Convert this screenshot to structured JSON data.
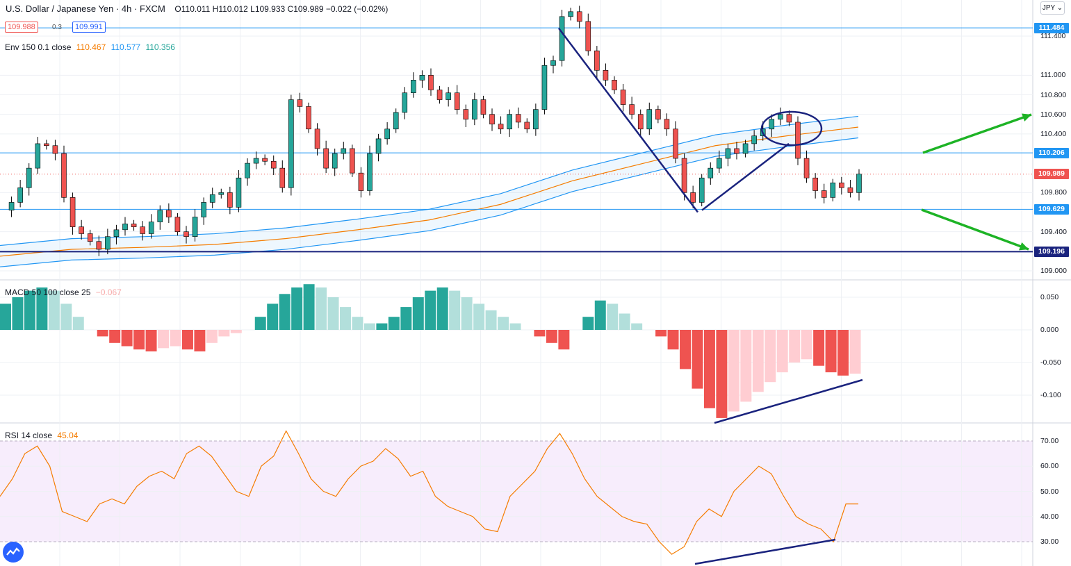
{
  "header": {
    "symbol": "U.S. Dollar / Japanese Yen · 4h · FXCM",
    "ohlc": "O110.011 H110.012 L109.933 C109.989 −0.022 (−0.02%)",
    "bid": "109.988",
    "spread": "0.3",
    "ask": "109.991",
    "currency_button": "JPY ⌄"
  },
  "indicators": {
    "env": {
      "label": "Env 150 0.1 close",
      "v1": "110.467",
      "v2": "110.577",
      "v3": "110.356",
      "c1": "#f57c00",
      "c2": "#2196f3",
      "c3": "#26a69a"
    },
    "macd": {
      "label": "MACD 50 100 close 25",
      "value": "−0.067"
    },
    "rsi": {
      "label": "RSI 14 close",
      "value": "45.04"
    }
  },
  "price_axis": [
    "111.400",
    "111.000",
    "110.800",
    "110.600",
    "110.400",
    "109.800",
    "109.400",
    "109.000"
  ],
  "price_tags": [
    {
      "label": "111.484",
      "color": "#2196f3"
    },
    {
      "label": "110.206",
      "color": "#2196f3"
    },
    {
      "label": "109.989",
      "color": "#ef5350"
    },
    {
      "label": "109.629",
      "color": "#2196f3"
    },
    {
      "label": "109.196",
      "color": "#1a237e"
    }
  ],
  "macd_axis": [
    "0.050",
    "0.000",
    "-0.050",
    "-0.100"
  ],
  "rsi_axis": [
    "70.00",
    "60.00",
    "50.00",
    "40.00",
    "30.00"
  ],
  "chart_data": {
    "type": "candlestick",
    "title": "U.S. Dollar / Japanese Yen · 4h · FXCM",
    "price_range": [
      108.93,
      111.72
    ],
    "horizontal_levels": [
      111.484,
      110.206,
      109.629,
      109.196
    ],
    "last_close": 109.989,
    "close_path": [
      109.62,
      109.7,
      109.85,
      110.05,
      110.3,
      110.28,
      110.2,
      109.75,
      109.45,
      109.38,
      109.3,
      109.22,
      109.35,
      109.42,
      109.48,
      109.45,
      109.38,
      109.5,
      109.62,
      109.55,
      109.4,
      109.35,
      109.55,
      109.7,
      109.78,
      109.8,
      109.65,
      109.95,
      110.1,
      110.15,
      110.12,
      110.05,
      109.85,
      110.75,
      110.68,
      110.45,
      110.25,
      110.05,
      110.2,
      110.25,
      110.0,
      109.82,
      110.2,
      110.35,
      110.45,
      110.62,
      110.82,
      110.95,
      111.0,
      110.85,
      110.75,
      110.82,
      110.65,
      110.55,
      110.75,
      110.6,
      110.5,
      110.45,
      110.6,
      110.52,
      110.45,
      110.65,
      111.1,
      111.15,
      111.6,
      111.65,
      111.55,
      111.25,
      111.05,
      110.95,
      110.85,
      110.7,
      110.6,
      110.45,
      110.65,
      110.55,
      110.45,
      110.15,
      109.8,
      109.7,
      109.95,
      110.05,
      110.15,
      110.25,
      110.2,
      110.3,
      110.38,
      110.45,
      110.55,
      110.6,
      110.52,
      110.15,
      109.95,
      109.82,
      109.75,
      109.9,
      109.85,
      109.8,
      109.989
    ],
    "envelope_mid_path": [
      109.15,
      109.22,
      109.24,
      109.27,
      109.33,
      109.42,
      109.52,
      109.68,
      109.92,
      110.1,
      110.28,
      110.38,
      110.47
    ],
    "envelope_band_percent": 0.1,
    "trendlines": [
      {
        "from": [
          804,
          111.48
        ],
        "to": [
          1004,
          109.6
        ]
      },
      {
        "from": [
          1010,
          109.62
        ],
        "to": [
          1135,
          110.3
        ]
      }
    ],
    "projection_arrows": [
      "up",
      "down"
    ],
    "macd_hist": [
      0.04,
      0.05,
      0.06,
      0.065,
      0.06,
      0.04,
      0.02,
      0.0,
      -0.01,
      -0.02,
      -0.025,
      -0.03,
      -0.033,
      -0.028,
      -0.025,
      -0.03,
      -0.033,
      -0.02,
      -0.01,
      -0.005,
      0.0,
      0.02,
      0.04,
      0.055,
      0.065,
      0.07,
      0.065,
      0.05,
      0.035,
      0.02,
      0.01,
      0.01,
      0.02,
      0.035,
      0.05,
      0.06,
      0.065,
      0.06,
      0.05,
      0.04,
      0.03,
      0.02,
      0.01,
      0.0,
      -0.01,
      -0.02,
      -0.03,
      0.0,
      0.02,
      0.045,
      0.04,
      0.025,
      0.01,
      0.0,
      -0.01,
      -0.03,
      -0.06,
      -0.09,
      -0.12,
      -0.135,
      -0.125,
      -0.11,
      -0.095,
      -0.08,
      -0.065,
      -0.05,
      -0.045,
      -0.055,
      -0.065,
      -0.07,
      -0.067
    ],
    "rsi_path": [
      48,
      55,
      65,
      68,
      60,
      42,
      40,
      38,
      45,
      47,
      45,
      52,
      56,
      58,
      55,
      65,
      68,
      64,
      57,
      50,
      48,
      60,
      64,
      74,
      65,
      55,
      50,
      48,
      55,
      60,
      62,
      67,
      63,
      56,
      58,
      48,
      44,
      42,
      40,
      35,
      34,
      48,
      53,
      58,
      67,
      73,
      65,
      55,
      48,
      44,
      40,
      38,
      37,
      30,
      25,
      28,
      38,
      43,
      40,
      50,
      55,
      60,
      57,
      48,
      40,
      37,
      35,
      30,
      45,
      45
    ]
  }
}
